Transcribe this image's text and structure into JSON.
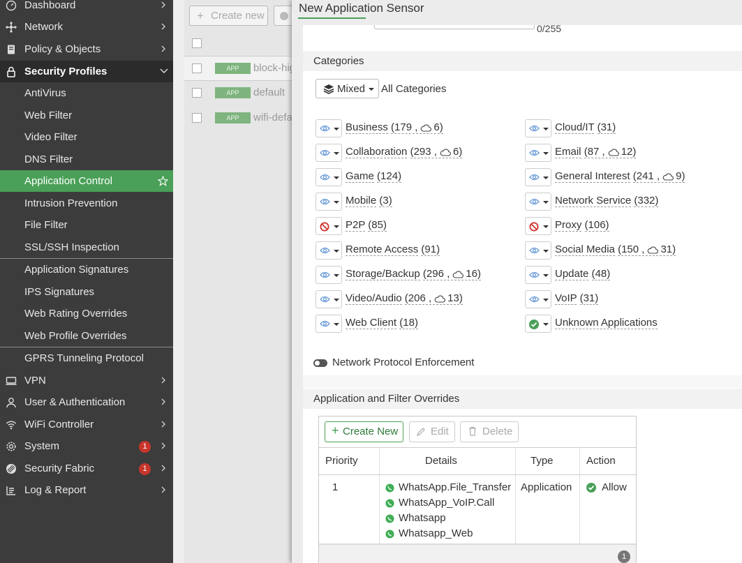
{
  "sidebar": {
    "items": [
      {
        "label": "Dashboard",
        "icon": "dashboard-icon"
      },
      {
        "label": "Network",
        "icon": "network-icon"
      },
      {
        "label": "Policy & Objects",
        "icon": "policy-icon"
      },
      {
        "label": "Security Profiles",
        "icon": "lock-icon"
      },
      {
        "label": "AntiVirus"
      },
      {
        "label": "Web Filter"
      },
      {
        "label": "Video Filter"
      },
      {
        "label": "DNS Filter"
      },
      {
        "label": "Application Control"
      },
      {
        "label": "Intrusion Prevention"
      },
      {
        "label": "File Filter"
      },
      {
        "label": "SSL/SSH Inspection"
      },
      {
        "label": "Application Signatures"
      },
      {
        "label": "IPS Signatures"
      },
      {
        "label": "Web Rating Overrides"
      },
      {
        "label": "Web Profile Overrides"
      },
      {
        "label": "GPRS Tunneling Protocol"
      },
      {
        "label": "VPN",
        "icon": "vpn-icon"
      },
      {
        "label": "User & Authentication",
        "icon": "user-icon"
      },
      {
        "label": "WiFi Controller",
        "icon": "wifi-icon"
      },
      {
        "label": "System",
        "icon": "gear-icon",
        "badge": "1"
      },
      {
        "label": "Security Fabric",
        "icon": "fabric-icon",
        "badge": "1"
      },
      {
        "label": "Log & Report",
        "icon": "report-icon"
      }
    ]
  },
  "background": {
    "create_new": "Create new",
    "tag": "APP",
    "rows": [
      "block-hig",
      "default",
      "wifi-defa"
    ]
  },
  "dialog": {
    "title": "New Application Sensor",
    "comment_counter": "0/255",
    "categories_header": "Categories",
    "mixed_label": "Mixed",
    "all_categories": "All Categories",
    "categories_left": [
      {
        "name": "Business",
        "count": "179",
        "cloud": "6",
        "action": "monitor"
      },
      {
        "name": "Collaboration",
        "count": "293",
        "cloud": "6",
        "action": "monitor"
      },
      {
        "name": "Game",
        "count": "124",
        "action": "monitor"
      },
      {
        "name": "Mobile",
        "count": "3",
        "action": "monitor"
      },
      {
        "name": "P2P",
        "count": "85",
        "action": "block"
      },
      {
        "name": "Remote Access",
        "count": "91",
        "action": "monitor"
      },
      {
        "name": "Storage/Backup",
        "count": "296",
        "cloud": "16",
        "action": "monitor"
      },
      {
        "name": "Video/Audio",
        "count": "206",
        "cloud": "13",
        "action": "monitor"
      },
      {
        "name": "Web Client",
        "count": "18",
        "action": "monitor"
      }
    ],
    "categories_right": [
      {
        "name": "Cloud/IT",
        "count": "31",
        "action": "monitor"
      },
      {
        "name": "Email",
        "count": "87",
        "cloud": "12",
        "action": "monitor"
      },
      {
        "name": "General Interest",
        "count": "241",
        "cloud": "9",
        "action": "monitor"
      },
      {
        "name": "Network Service",
        "count": "332",
        "action": "monitor"
      },
      {
        "name": "Proxy",
        "count": "106",
        "action": "block"
      },
      {
        "name": "Social Media",
        "count": "150",
        "cloud": "31",
        "action": "monitor"
      },
      {
        "name": "Update",
        "count": "48",
        "action": "monitor"
      },
      {
        "name": "VoIP",
        "count": "31",
        "action": "monitor"
      },
      {
        "name": "Unknown Applications",
        "action": "allow"
      }
    ],
    "network_protocol_enforcement": "Network Protocol Enforcement",
    "overrides_header": "Application and Filter Overrides",
    "overrides": {
      "create_new": "Create New",
      "edit": "Edit",
      "delete": "Delete",
      "columns": [
        "Priority",
        "Details",
        "Type",
        "Action"
      ],
      "row": {
        "priority": "1",
        "details": [
          "WhatsApp.File_Transfer",
          "WhatsApp_VoIP.Call",
          "Whatsapp",
          "Whatsapp_Web"
        ],
        "type": "Application",
        "action": "Allow"
      },
      "page_count": "1"
    }
  },
  "colors": {
    "sidebar_bg": "#3c3c3c",
    "accent_green": "#4aa058",
    "block_red": "#d0312d",
    "badge_red": "#c8352b"
  }
}
